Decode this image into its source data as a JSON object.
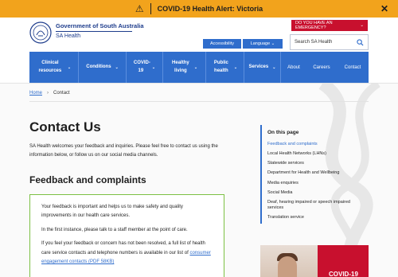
{
  "alert": {
    "text": "COVID-19 Health Alert: Victoria",
    "icon": "warning-icon",
    "close": "✕"
  },
  "header": {
    "org_name": "Government of South Australia",
    "site_name": "SA Health",
    "emergency_label": "DO YOU HAVE AN EMERGENCY?",
    "emergency_chevron": "⌄",
    "accessibility_label": "Accessibility",
    "language_label": "Language ⌄",
    "search_placeholder": "Search SA Health"
  },
  "nav": {
    "items": [
      {
        "label": "Clinical resources",
        "has_dropdown": true
      },
      {
        "label": "Conditions",
        "has_dropdown": true
      },
      {
        "label": "COVID-19",
        "has_dropdown": true
      },
      {
        "label": "Healthy living",
        "has_dropdown": true
      },
      {
        "label": "Public health",
        "has_dropdown": true
      },
      {
        "label": "Services",
        "has_dropdown": true
      }
    ],
    "plain_links": [
      "About",
      "Careers",
      "Contact"
    ],
    "chevron": "⌄"
  },
  "breadcrumb": {
    "home": "Home",
    "separator": "›",
    "current": "Contact"
  },
  "main": {
    "title": "Contact Us",
    "intro": "SA Health welcomes your feedback and inquiries. Please feel free to contact us using the information below, or follow us on our social media channels.",
    "section_title": "Feedback and complaints",
    "box": {
      "p1": "Your feedback is important and helps us to make safety and quality improvements in our health care services.",
      "p2": "In the first instance, please talk to a staff member at the point of care.",
      "p3_prefix": "If you feel your feedback or concern has not been resolved, a full list of health care service contacts and telephone numbers is available in our list of ",
      "p3_link": "consumer engagement contacts (PDF 58KB)"
    }
  },
  "sidebar": {
    "title": "On this page",
    "links": [
      "Feedback and complaints",
      "Local Health Networks (LHNs)",
      "Statewide services",
      "Department for Health and Wellbeing",
      "Media enquiries",
      "Social Media",
      "Deaf, hearing impaired or speech impaired services",
      "Translation service"
    ],
    "active_index": 0
  },
  "promo": {
    "text": "COVID-19"
  },
  "colors": {
    "accent_blue": "#2f6dcc",
    "alert_orange": "#f2a31c",
    "emergency_red": "#c8102e",
    "box_green": "#7bc043",
    "brand_navy": "#1e3d8c"
  }
}
